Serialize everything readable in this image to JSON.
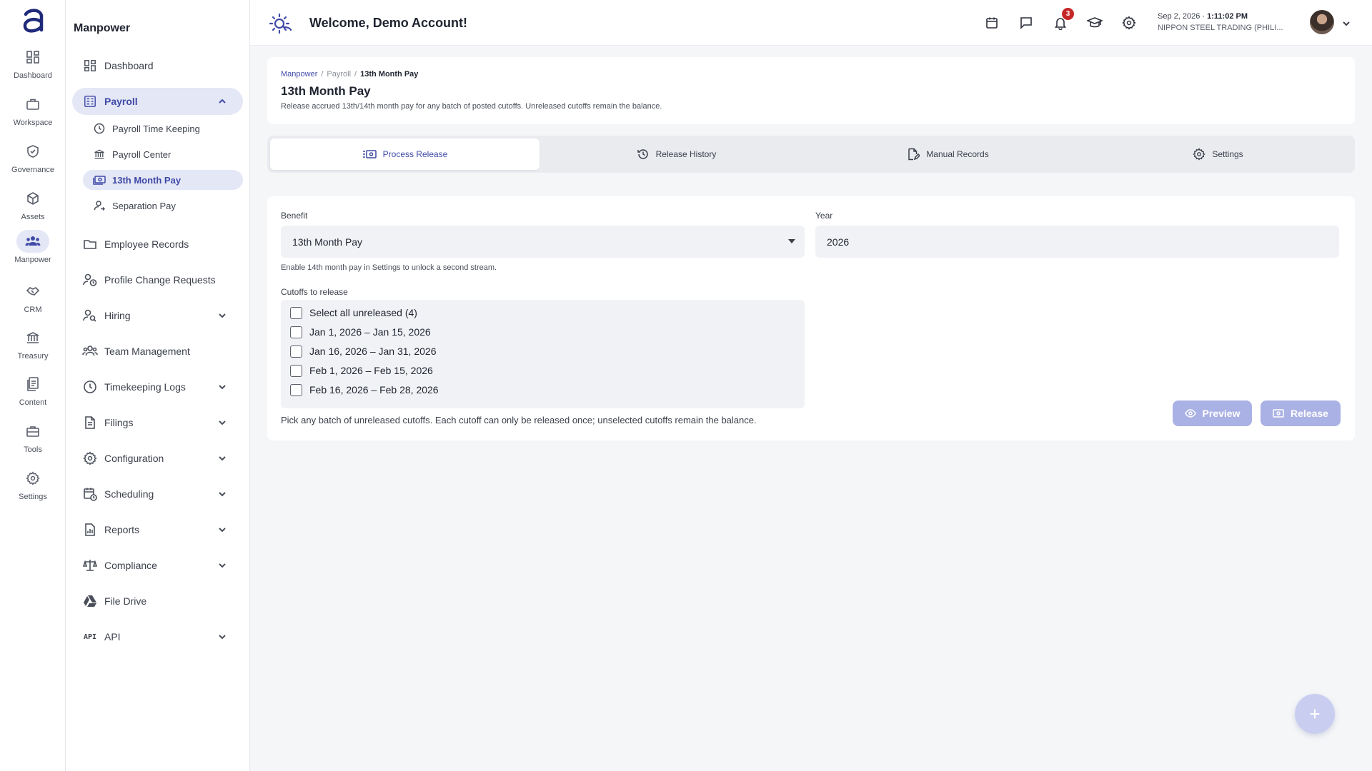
{
  "rail": {
    "items": [
      {
        "label": "Dashboard",
        "icon": "dashboard-icon"
      },
      {
        "label": "Workspace",
        "icon": "briefcase-icon"
      },
      {
        "label": "Governance",
        "icon": "shield-check-icon"
      },
      {
        "label": "Assets",
        "icon": "cube-icon"
      },
      {
        "label": "Manpower",
        "icon": "people-icon"
      },
      {
        "label": "CRM",
        "icon": "handshake-icon"
      },
      {
        "label": "Treasury",
        "icon": "bank-icon"
      },
      {
        "label": "Content",
        "icon": "documents-icon"
      },
      {
        "label": "Tools",
        "icon": "toolbox-icon"
      },
      {
        "label": "Settings",
        "icon": "gear-icon"
      }
    ],
    "active": "Manpower"
  },
  "sidebar": {
    "title": "Manpower",
    "items": [
      {
        "label": "Dashboard"
      },
      {
        "label": "Payroll"
      },
      {
        "label": "Employee Records"
      },
      {
        "label": "Profile Change Requests"
      },
      {
        "label": "Hiring"
      },
      {
        "label": "Team Management"
      },
      {
        "label": "Timekeeping Logs"
      },
      {
        "label": "Filings"
      },
      {
        "label": "Configuration"
      },
      {
        "label": "Scheduling"
      },
      {
        "label": "Reports"
      },
      {
        "label": "Compliance"
      },
      {
        "label": "File Drive"
      },
      {
        "label": "API"
      }
    ],
    "payroll_sub": [
      {
        "label": "Payroll Time Keeping"
      },
      {
        "label": "Payroll Center"
      },
      {
        "label": "13th Month Pay"
      },
      {
        "label": "Separation Pay"
      }
    ],
    "api_icon_text": "API"
  },
  "header": {
    "welcome": "Welcome, Demo Account!",
    "notification_count": "3",
    "date": "Sep 2, 2026",
    "date_sep": " · ",
    "time": "1:11:02 PM",
    "company": "NIPPON STEEL TRADING (PHILI..."
  },
  "page": {
    "breadcrumb": [
      "Manpower",
      "Payroll",
      "13th Month Pay"
    ],
    "breadcrumb_sep": "/",
    "title": "13th Month Pay",
    "subtitle": "Release accrued 13th/14th month pay for any batch of posted cutoffs. Unreleased cutoffs remain the balance."
  },
  "tabs": [
    {
      "label": "Process Release"
    },
    {
      "label": "Release History"
    },
    {
      "label": "Manual Records"
    },
    {
      "label": "Settings"
    }
  ],
  "form": {
    "benefit_label": "Benefit",
    "benefit_value": "13th Month Pay",
    "year_label": "Year",
    "year_value": "2026",
    "benefit_help": "Enable 14th month pay in Settings to unlock a second stream.",
    "cutoffs_label": "Cutoffs to release",
    "select_all": "Select all unreleased (4)",
    "cutoffs": [
      "Jan 1, 2026 – Jan 15, 2026",
      "Jan 16, 2026 – Jan 31, 2026",
      "Feb 1, 2026 – Feb 15, 2026",
      "Feb 16, 2026 – Feb 28, 2026"
    ],
    "cutoffs_help": "Pick any batch of unreleased cutoffs. Each cutoff can only be released once; unselected cutoffs remain the balance.",
    "preview_label": "Preview",
    "release_label": "Release"
  },
  "fab": {
    "label": "+"
  },
  "colors": {
    "accent": "#3f4aa6",
    "accent_soft": "#e4e7f6",
    "button_disabled": "#aab1e4",
    "badge": "#c62828"
  }
}
